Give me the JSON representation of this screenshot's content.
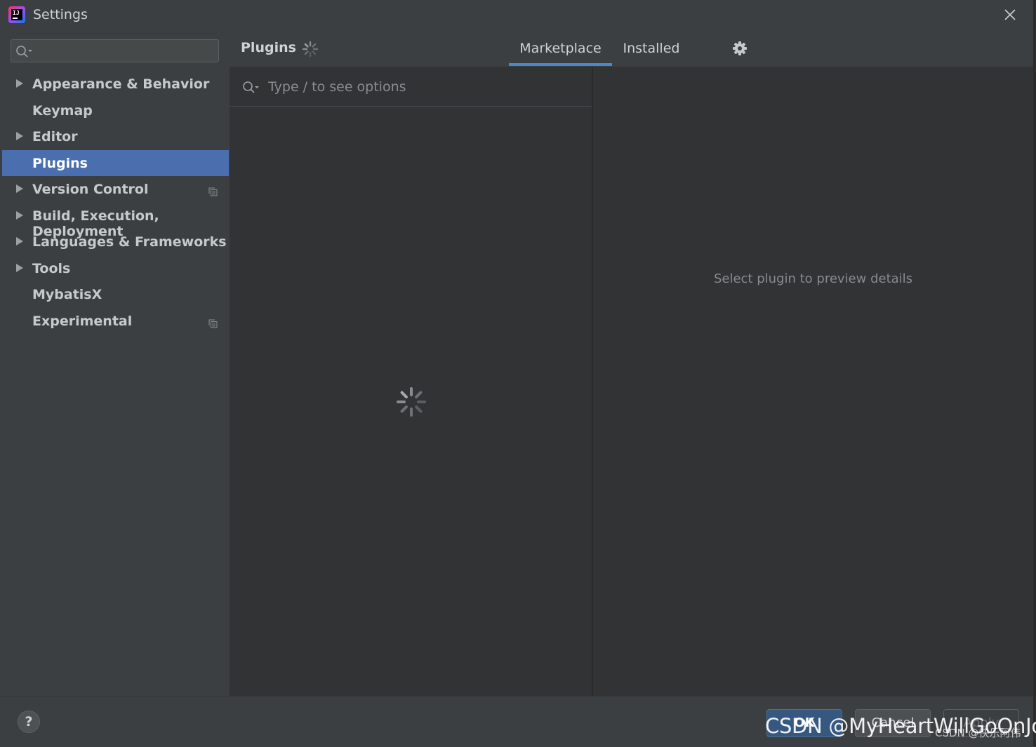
{
  "window": {
    "title": "Settings",
    "logo_text": "IJ"
  },
  "sidebar": {
    "search_placeholder": "",
    "items": [
      {
        "label": "Appearance & Behavior",
        "expandable": true,
        "selected": false,
        "has_copy_icon": false
      },
      {
        "label": "Keymap",
        "expandable": false,
        "selected": false,
        "has_copy_icon": false
      },
      {
        "label": "Editor",
        "expandable": true,
        "selected": false,
        "has_copy_icon": false
      },
      {
        "label": "Plugins",
        "expandable": false,
        "selected": true,
        "has_copy_icon": false
      },
      {
        "label": "Version Control",
        "expandable": true,
        "selected": false,
        "has_copy_icon": true
      },
      {
        "label": "Build, Execution, Deployment",
        "expandable": true,
        "selected": false,
        "has_copy_icon": false
      },
      {
        "label": "Languages & Frameworks",
        "expandable": true,
        "selected": false,
        "has_copy_icon": false
      },
      {
        "label": "Tools",
        "expandable": true,
        "selected": false,
        "has_copy_icon": false
      },
      {
        "label": "MybatisX",
        "expandable": false,
        "selected": false,
        "has_copy_icon": false
      },
      {
        "label": "Experimental",
        "expandable": false,
        "selected": false,
        "has_copy_icon": true
      }
    ]
  },
  "main": {
    "header": "Plugins",
    "tabs": [
      {
        "label": "Marketplace",
        "active": true
      },
      {
        "label": "Installed",
        "active": false
      }
    ],
    "search_placeholder": "Type / to see options",
    "detail_empty_text": "Select plugin to preview details"
  },
  "buttons": {
    "help": "?",
    "ok": "OK",
    "cancel": "Cancel",
    "apply": "Apply"
  },
  "watermark": {
    "main": "CSDN @MyHeartWillGoOnJolly",
    "small": "CSDN @快乐阿伟"
  },
  "colors": {
    "accent": "#4b6eaf",
    "tab_underline": "#4a88c7",
    "background": "#3c3f41",
    "pane": "#313335"
  },
  "icons": [
    "app-logo",
    "search-icon",
    "close-icon",
    "expand-arrow-icon",
    "copy-icon",
    "spinner-icon",
    "gear-icon",
    "help-icon"
  ]
}
